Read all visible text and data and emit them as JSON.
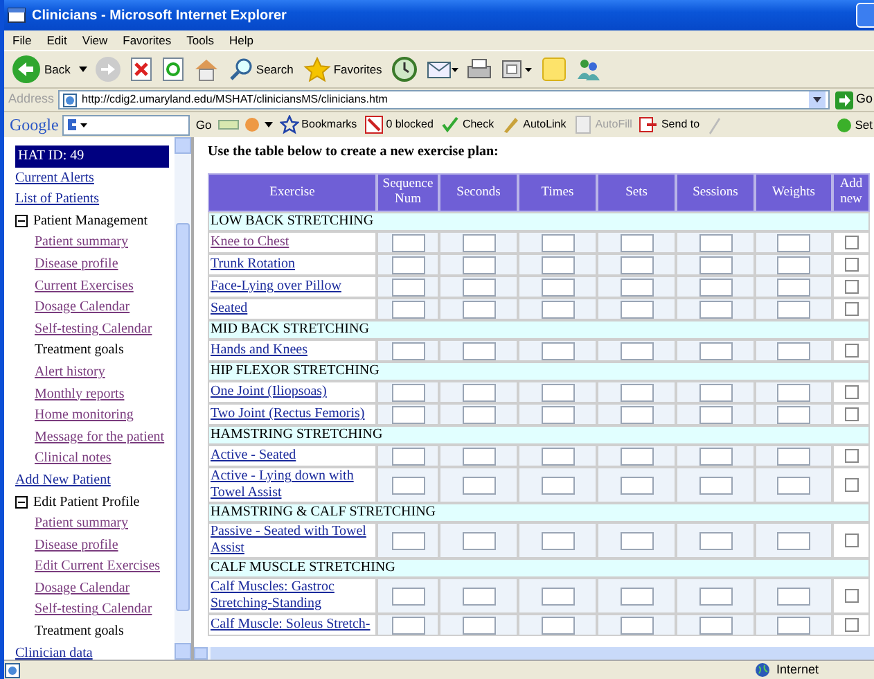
{
  "window": {
    "title": "Clinicians - Microsoft Internet Explorer"
  },
  "menu": [
    "File",
    "Edit",
    "View",
    "Favorites",
    "Tools",
    "Help"
  ],
  "toolbar": {
    "back": "Back",
    "search": "Search",
    "favorites": "Favorites"
  },
  "address_bar": {
    "label": "Address",
    "url": "http://cdig2.umaryland.edu/MSHAT/cliniciansMS/clinicians.htm",
    "go": "Go"
  },
  "google_toolbar": {
    "logo": "Google",
    "go": "Go",
    "items": [
      {
        "label": "Bookmarks",
        "disabled": false
      },
      {
        "label": "0 blocked",
        "disabled": false
      },
      {
        "label": "Check",
        "disabled": false
      },
      {
        "label": "AutoLink",
        "disabled": false
      },
      {
        "label": "AutoFill",
        "disabled": true
      },
      {
        "label": "Send to",
        "disabled": false
      }
    ],
    "settings": "Set"
  },
  "sidebar": {
    "id_label": "HAT ID: 49",
    "items": [
      {
        "label": "Current Alerts",
        "kind": "link",
        "visited": false
      },
      {
        "label": "List of Patients",
        "kind": "link",
        "visited": false
      },
      {
        "label": "Patient Management",
        "kind": "group",
        "expanded": true,
        "children": [
          {
            "label": "Patient summary",
            "kind": "link",
            "visited": true
          },
          {
            "label": "Disease profile",
            "kind": "link",
            "visited": true
          },
          {
            "label": "Current Exercises",
            "kind": "link",
            "visited": true
          },
          {
            "label": "Dosage Calendar",
            "kind": "link",
            "visited": true
          },
          {
            "label": "Self-testing Calendar",
            "kind": "link",
            "visited": true
          },
          {
            "label": "Treatment goals",
            "kind": "text"
          },
          {
            "label": "Alert history",
            "kind": "link",
            "visited": true
          },
          {
            "label": "Monthly reports",
            "kind": "link",
            "visited": true
          },
          {
            "label": "Home monitoring",
            "kind": "link",
            "visited": true
          },
          {
            "label": "Message for the patient",
            "kind": "link",
            "visited": true
          },
          {
            "label": "Clinical notes",
            "kind": "link",
            "visited": true
          }
        ]
      },
      {
        "label": "Add New Patient",
        "kind": "link",
        "visited": false
      },
      {
        "label": "Edit Patient Profile",
        "kind": "group",
        "expanded": true,
        "children": [
          {
            "label": "Patient summary",
            "kind": "link",
            "visited": true
          },
          {
            "label": "Disease profile",
            "kind": "link",
            "visited": true
          },
          {
            "label": "Edit Current Exercises",
            "kind": "link",
            "visited": true
          },
          {
            "label": "Dosage Calendar",
            "kind": "link",
            "visited": true
          },
          {
            "label": "Self-testing Calendar",
            "kind": "link",
            "visited": true
          },
          {
            "label": "Treatment goals",
            "kind": "text"
          }
        ]
      },
      {
        "label": "Clinician data",
        "kind": "link",
        "visited": false
      }
    ]
  },
  "content": {
    "instruction": "Use the table below to create a new exercise plan:",
    "columns": [
      "Exercise",
      "Sequence Num",
      "Seconds",
      "Times",
      "Sets",
      "Sessions",
      "Weights",
      "Add new"
    ],
    "groups": [
      {
        "title": "LOW BACK STRETCHING",
        "exercises": [
          {
            "name": "Knee to Chest",
            "visited": true,
            "add_new": false
          },
          {
            "name": "Trunk Rotation",
            "visited": false,
            "add_new": false
          },
          {
            "name": "Face-Lying over Pillow",
            "visited": false,
            "add_new": false
          },
          {
            "name": "Seated",
            "visited": false,
            "add_new": false
          }
        ]
      },
      {
        "title": "MID BACK STRETCHING",
        "exercises": [
          {
            "name": "Hands and Knees",
            "visited": false,
            "add_new": false
          }
        ]
      },
      {
        "title": "HIP FLEXOR STRETCHING",
        "exercises": [
          {
            "name": "One Joint (Iliopsoas)",
            "visited": false,
            "add_new": false
          },
          {
            "name": "Two Joint (Rectus Femoris)",
            "visited": false,
            "add_new": false
          }
        ]
      },
      {
        "title": "HAMSTRING STRETCHING",
        "exercises": [
          {
            "name": "Active - Seated",
            "visited": false,
            "add_new": false
          },
          {
            "name": "Active - Lying down with Towel Assist",
            "visited": false,
            "add_new": false
          }
        ]
      },
      {
        "title": "HAMSTRING & CALF STRETCHING",
        "exercises": [
          {
            "name": "Passive - Seated with Towel Assist",
            "visited": false,
            "add_new": false
          }
        ]
      },
      {
        "title": "CALF MUSCLE STRETCHING",
        "exercises": [
          {
            "name": "Calf Muscles: Gastroc Stretching-Standing",
            "visited": false,
            "add_new": false
          },
          {
            "name": "Calf Muscle: Soleus Stretch-",
            "visited": false,
            "add_new": false
          }
        ]
      }
    ]
  },
  "status_bar": {
    "zone": "Internet"
  }
}
